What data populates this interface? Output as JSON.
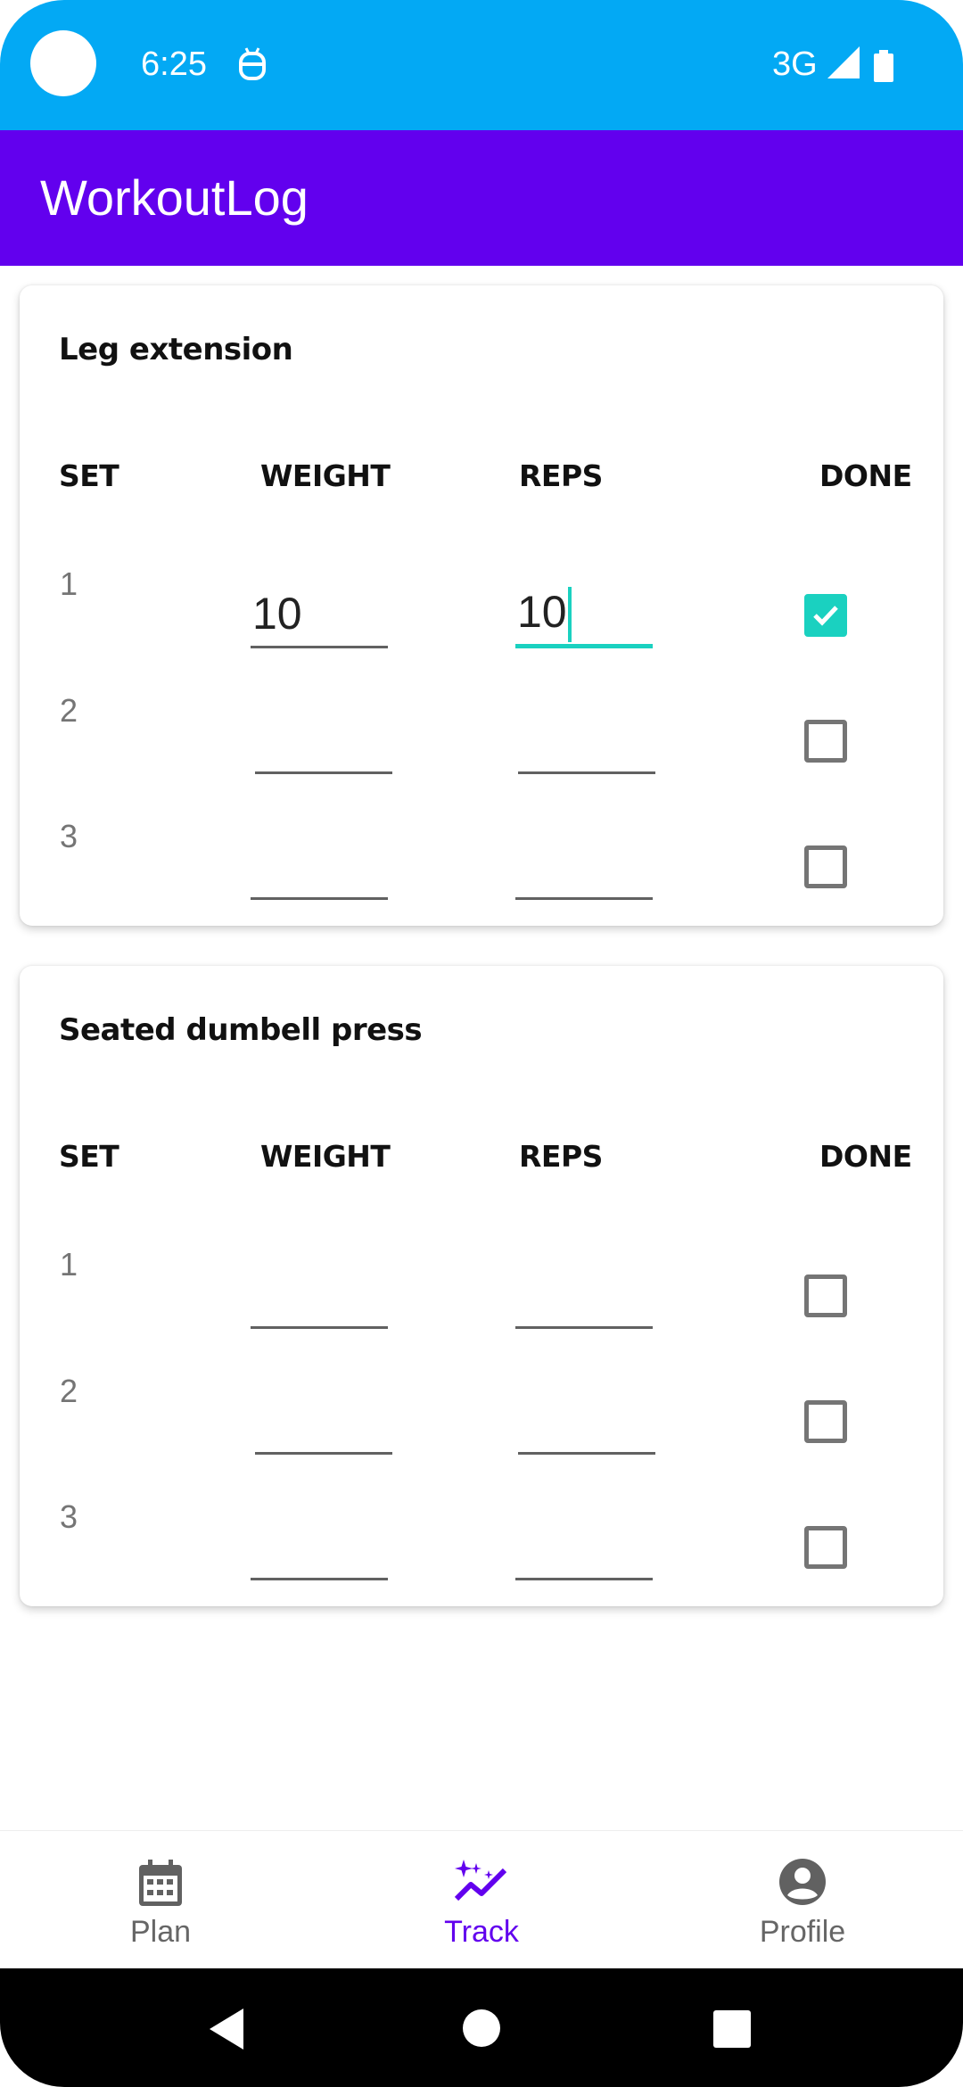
{
  "status_bar": {
    "time": "6:25",
    "network": "3G",
    "colors": {
      "background": "#03a9f4"
    }
  },
  "app_bar": {
    "title": "WorkoutLog",
    "colors": {
      "background": "#6200ee"
    }
  },
  "column_headers": {
    "set": "SET",
    "weight": "WEIGHT",
    "reps": "REPS",
    "done": "DONE"
  },
  "exercises": [
    {
      "name": "Leg extension",
      "sets": [
        {
          "set": "1",
          "weight": "10",
          "reps": "10",
          "done": true
        },
        {
          "set": "2",
          "weight": "",
          "reps": "",
          "done": false
        },
        {
          "set": "3",
          "weight": "",
          "reps": "",
          "done": false
        }
      ]
    },
    {
      "name": "Seated dumbell press",
      "sets": [
        {
          "set": "1",
          "weight": "",
          "reps": "",
          "done": false
        },
        {
          "set": "2",
          "weight": "",
          "reps": "",
          "done": false
        },
        {
          "set": "3",
          "weight": "",
          "reps": "",
          "done": false
        }
      ]
    }
  ],
  "bottom_nav": {
    "items": [
      {
        "label": "Plan",
        "icon": "calendar-icon",
        "selected": false
      },
      {
        "label": "Track",
        "icon": "sparkle-trend-icon",
        "selected": true
      },
      {
        "label": "Profile",
        "icon": "account-circle-icon",
        "selected": false
      }
    ],
    "colors": {
      "active": "#6200ee",
      "inactive": "#666666"
    }
  },
  "accent_color": "#1ad1c0"
}
